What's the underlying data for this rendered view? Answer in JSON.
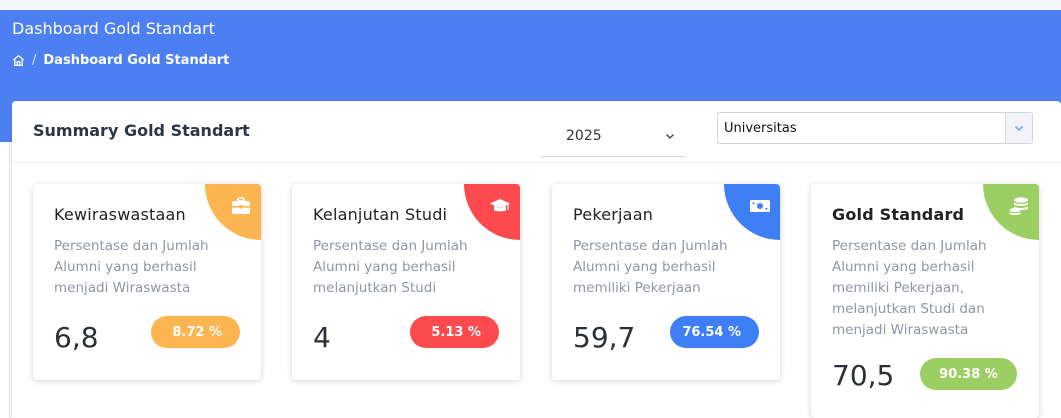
{
  "header": {
    "title": "Dashboard Gold Standart",
    "breadcrumb_separator": "/",
    "breadcrumb_current": "Dashboard Gold Standart"
  },
  "summary": {
    "title": "Summary Gold Standart",
    "year_select": {
      "value": "2025"
    },
    "scope_select": {
      "value": "Universitas"
    }
  },
  "colors": {
    "header_blue": "#4c7ff2",
    "orange": "#fcb550",
    "red": "#fc4a4f",
    "blue": "#3f7ff6",
    "green": "#9ccf63"
  },
  "cards": [
    {
      "title": "Kewiraswastaan",
      "description": "Persentase dan Jumlah Alumni yang berhasil menjadi Wiraswasta",
      "value": "6,8",
      "percent": "8.72 %",
      "icon": "briefcase-icon",
      "color": "#fcb550"
    },
    {
      "title": "Kelanjutan Studi",
      "description": "Persentase dan Jumlah Alumni yang berhasil melanjutkan Studi",
      "value": "4",
      "percent": "5.13 %",
      "icon": "graduation-cap-icon",
      "color": "#fc4a4f"
    },
    {
      "title": "Pekerjaan",
      "description": "Persentase dan Jumlah Alumni yang berhasil memiliki Pekerjaan",
      "value": "59,7",
      "percent": "76.54 %",
      "icon": "money-bill-icon",
      "color": "#3f7ff6"
    },
    {
      "title": "Gold Standard",
      "description": "Persentase dan Jumlah Alumni yang berhasil memiliki Pekerjaan, melanjutkan Studi dan menjadi Wiraswasta",
      "value": "70,5",
      "percent": "90.38 %",
      "icon": "coins-icon",
      "color": "#9ccf63"
    }
  ]
}
